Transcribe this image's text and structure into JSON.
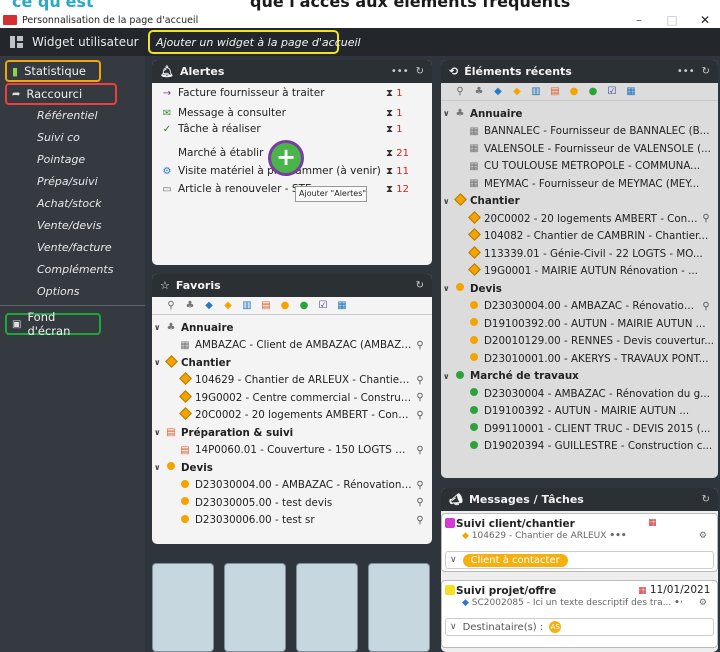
{
  "top_caption": {
    "left": "ce qu'est",
    "right": "que l'accès aux éléments fréquents"
  },
  "window": {
    "title": "Personnalisation de la page d'accueil",
    "minimize": "–",
    "maximize": "□",
    "close": "✕"
  },
  "header": {
    "widget_label": "Widget utilisateur",
    "add_widget_label": "Ajouter un widget à la page d'accueil"
  },
  "sidebar": {
    "statistique": "Statistique",
    "raccourci": "Raccourci",
    "subitems": [
      "Référentiel",
      "Suivi co",
      "Pointage",
      "Prépa/suivi",
      "Achat/stock",
      "Vente/devis",
      "Vente/facture",
      "Compléments",
      "Options"
    ],
    "fond": "Fond d'écran"
  },
  "alertes": {
    "title": "Alertes",
    "rows": [
      {
        "text": "Facture fournisseur à traiter",
        "count": "1"
      },
      {
        "text": "Message à consulter",
        "count": "1"
      },
      {
        "text": "Tâche à réaliser",
        "count": "1"
      },
      {
        "text": "Marché à établir",
        "count": "21"
      },
      {
        "text": "Visite matériel à programmer (à venir)",
        "count": "11"
      },
      {
        "text": "Article à renouveler - STE",
        "count": "12"
      }
    ],
    "fab": "+",
    "tooltip": "Ajouter \"Alertes\""
  },
  "recents": {
    "title": "Éléments récents",
    "groups": [
      {
        "label": "Annuaire",
        "items": [
          "BANNALEC - Fournisseur de BANNALEC (B...",
          "VALENSOLE - Fournisseur de VALENSOLE (...",
          "CU TOULOUSE MÉTROPOLE - COMMUNA...",
          "MEYMAC - Fournisseur de MEYMAC (MEY..."
        ]
      },
      {
        "label": "Chantier",
        "items": [
          "20C0002 - 20 logements AMBERT - Constr...",
          "104082 - Chantier de CAMBRIN - Chantier...",
          "113339.01 - Génie-Civil - 22 LOGTS - MO...",
          "19G0001 - MAIRIE AUTUN Rénovation - ..."
        ]
      },
      {
        "label": "Devis",
        "items": [
          "D23030004.00 - AMBAZAC - Rénovation d...",
          "D19100392.00 - AUTUN - MAIRIE AUTUN ...",
          "D20010129.00 - RENNES - Devis couvertur...",
          "D23010001.00 - AKERYS - TRAVAUX PONT..."
        ]
      },
      {
        "label": "Marché de travaux",
        "items": [
          "D23030004 - AMBAZAC - Rénovation du g...",
          "D19100392 - AUTUN - MAIRIE AUTUN ...",
          "D99110001 - CLIENT TRUC - DEVIS 2015 (...",
          "D19020394 - GUILLESTRE - Construction c..."
        ]
      }
    ]
  },
  "favoris": {
    "title": "Favoris",
    "groups": [
      {
        "label": "Annuaire",
        "items": [
          "AMBAZAC - Client de AMBAZAC (AMBAZA..."
        ]
      },
      {
        "label": "Chantier",
        "items": [
          "104629 - Chantier de ARLEUX - Chantier d...",
          "19G0002 - Centre commercial - Constructi...",
          "20C0002 - 20 logements AMBERT - Constr..."
        ]
      },
      {
        "label": "Préparation & suivi",
        "items": [
          "14P0060.01 - Couverture - 150 LOGTS MA..."
        ]
      },
      {
        "label": "Devis",
        "items": [
          "D23030004.00 - AMBAZAC - Rénovation d...",
          "D23030005.00 - test devis",
          "D23030006.00 - test sr"
        ]
      }
    ]
  },
  "messages": {
    "title": "Messages / Tâches",
    "cards": [
      {
        "title": "Suivi client/chantier",
        "sub": "104629 - Chantier de ARLEUX",
        "footer": "Client à contacter",
        "date": ""
      },
      {
        "title": "Suivi projet/offre",
        "sub": "SC2002085 - Ici un texte descriptif des tra...",
        "footer": "Destinataire(s) :",
        "date": "11/01/2021",
        "avatar": "AS"
      }
    ]
  },
  "colors": {
    "accent_yellow": "#f0e323",
    "orange_border": "#f3a60a",
    "red_border": "#ec4040",
    "green_border": "#1fa63a",
    "fab_green": "#48b44a",
    "fab_ring": "#7c3aa3",
    "pill": "#f5b010"
  }
}
